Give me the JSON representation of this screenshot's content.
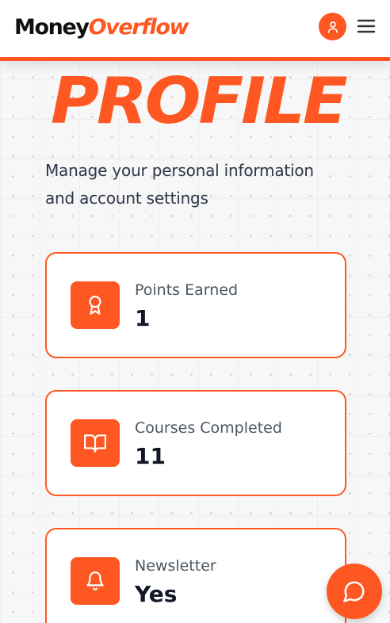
{
  "header": {
    "logo_part1": "Money",
    "logo_part2": "Overflow",
    "icons": {
      "profile": "user-icon",
      "menu": "hamburger-menu-icon"
    }
  },
  "hero": {
    "title": "PROFILE",
    "subtitle": "Manage your personal information and account settings"
  },
  "stats": [
    {
      "label": "Points Earned",
      "value": "1",
      "icon": "award-icon"
    },
    {
      "label": "Courses Completed",
      "value": "11",
      "icon": "book-open-icon"
    },
    {
      "label": "Newsletter",
      "value": "Yes",
      "icon": "bell-icon"
    }
  ],
  "chat": {
    "icon": "chat-bubble-icon"
  },
  "colors": {
    "accent": "#ff5722",
    "text": "#111111",
    "muted": "#4b5563"
  }
}
